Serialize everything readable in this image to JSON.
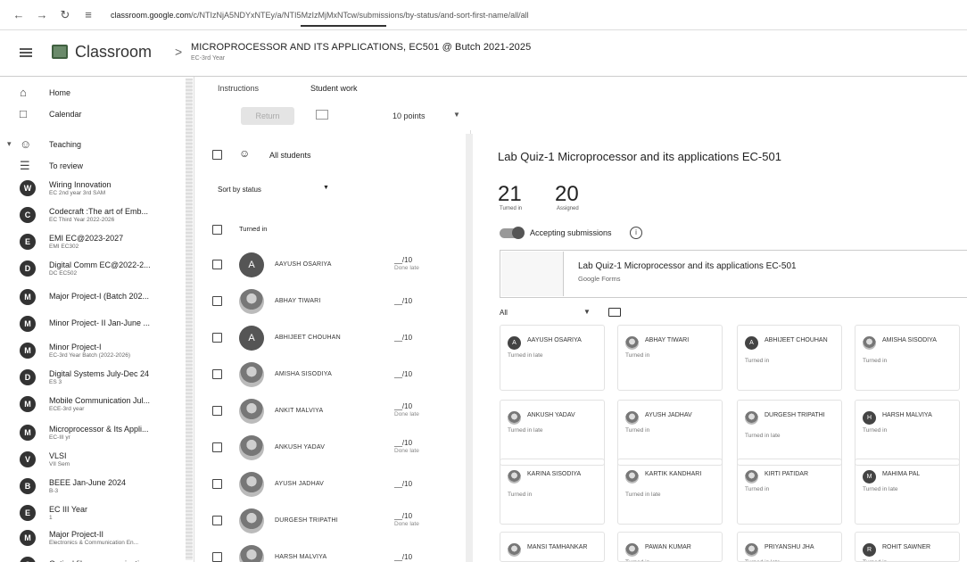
{
  "browser": {
    "url_host": "classroom.google.com",
    "url_path": "/c/NTIzNjA5NDYxNTEy/a/NTI5MzIzMjMxNTcw/submissions/by-status/and-sort-first-name/all/all"
  },
  "header": {
    "app_name": "Classroom",
    "separator": ">",
    "class_title": "MICROPROCESSOR AND ITS APPLICATIONS, EC501 @ Butch 2021-2025",
    "class_sub": "EC-3rd Year"
  },
  "sidebar": {
    "items": [
      {
        "title": "Home",
        "sub": "",
        "icon": "home-icon",
        "initial": ""
      },
      {
        "title": "Calendar",
        "sub": "",
        "icon": "calendar-icon",
        "initial": ""
      },
      {
        "title": "Teaching",
        "sub": "",
        "icon": "people-icon",
        "initial": ""
      },
      {
        "title": "To review",
        "sub": "",
        "icon": "review-icon",
        "initial": ""
      },
      {
        "title": "Wiring Innovation",
        "sub": "EC 2nd year 3rd SAM",
        "icon": "class-icon",
        "initial": "W"
      },
      {
        "title": "Codecraft :The art of Emb...",
        "sub": "EC Third Year 2022-2026",
        "icon": "class-icon",
        "initial": "C"
      },
      {
        "title": "EMI EC@2023-2027",
        "sub": "EMI EC302",
        "icon": "class-icon",
        "initial": "E"
      },
      {
        "title": "Digital Comm EC@2022-2...",
        "sub": "DC EC502",
        "icon": "class-icon",
        "initial": "D"
      },
      {
        "title": "Major Project-I (Batch 202...",
        "sub": "",
        "icon": "class-icon",
        "initial": "M"
      },
      {
        "title": "Minor Project- II Jan-June ...",
        "sub": "",
        "icon": "class-icon",
        "initial": "M"
      },
      {
        "title": "Minor Project-I",
        "sub": "EC-3rd Year Batch (2022-2026)",
        "icon": "class-icon",
        "initial": "M"
      },
      {
        "title": "Digital Systems July-Dec 24",
        "sub": "ES 3",
        "icon": "class-icon",
        "initial": "D"
      },
      {
        "title": "Mobile Communication Jul...",
        "sub": "ECE-3rd year",
        "icon": "class-icon",
        "initial": "M"
      },
      {
        "title": "Microprocessor & Its Appli...",
        "sub": "EC-III yr",
        "icon": "class-icon",
        "initial": "M"
      },
      {
        "title": "VLSI",
        "sub": "VII Sem",
        "icon": "class-icon",
        "initial": "V"
      },
      {
        "title": "BEEE Jan-June 2024",
        "sub": "B-3",
        "icon": "class-icon",
        "initial": "B"
      },
      {
        "title": "EC III Year",
        "sub": "1",
        "icon": "class-icon",
        "initial": "E"
      },
      {
        "title": "Major Project-II",
        "sub": "Electronics & Communication En...",
        "icon": "class-icon",
        "initial": "M"
      },
      {
        "title": "Optical fiber communicati...",
        "sub": "",
        "icon": "class-icon",
        "initial": "O"
      }
    ]
  },
  "tabs": {
    "instructions": "Instructions",
    "student_work": "Student work"
  },
  "toolbar": {
    "return_label": "Return",
    "points": "10 points"
  },
  "list": {
    "all_students": "All students",
    "sort_by": "Sort by status",
    "turned_in_header": "Turned in",
    "students": [
      {
        "name": "AAYUSH OSARIYA",
        "score": "__/10",
        "note": "Done late",
        "initial": "A",
        "photo": false
      },
      {
        "name": "ABHAY TIWARI",
        "score": "__/10",
        "note": "",
        "initial": "",
        "photo": true
      },
      {
        "name": "ABHIJEET CHOUHAN",
        "score": "__/10",
        "note": "",
        "initial": "A",
        "photo": false
      },
      {
        "name": "AMISHA SISODIYA",
        "score": "__/10",
        "note": "",
        "initial": "",
        "photo": true
      },
      {
        "name": "ANKIT MALVIYA",
        "score": "__/10",
        "note": "Done late",
        "initial": "",
        "photo": true
      },
      {
        "name": "ANKUSH YADAV",
        "score": "__/10",
        "note": "Done late",
        "initial": "",
        "photo": true
      },
      {
        "name": "AYUSH JADHAV",
        "score": "__/10",
        "note": "",
        "initial": "",
        "photo": true
      },
      {
        "name": "DURGESH TRIPATHI",
        "score": "__/10",
        "note": "Done late",
        "initial": "",
        "photo": true
      },
      {
        "name": "HARSH MALVIYA",
        "score": "__/10",
        "note": "",
        "initial": "",
        "photo": true
      }
    ]
  },
  "assignment": {
    "title": "Lab Quiz-1 Microprocessor and its applications EC-501",
    "turned_in_count": "21",
    "turned_in_label": "Turned in",
    "assigned_count": "20",
    "assigned_label": "Assigned",
    "accepting": "Accepting submissions",
    "form_title": "Lab Quiz-1 Microprocessor and its applications EC-501",
    "form_sub": "Google Forms",
    "filter": "All"
  },
  "grid": [
    {
      "name": "AAYUSH OSARIYA",
      "status": "Turned in late",
      "initial": "A",
      "photo": false
    },
    {
      "name": "ABHAY TIWARI",
      "status": "Turned in",
      "initial": "",
      "photo": true
    },
    {
      "name": "ABHIJEET CHOUHAN",
      "status": "Turned in",
      "initial": "A",
      "photo": false
    },
    {
      "name": "AMISHA SISODIYA",
      "status": "Turned in",
      "initial": "",
      "photo": true
    },
    {
      "name": "ANKUSH YADAV",
      "status": "Turned in late",
      "initial": "",
      "photo": true
    },
    {
      "name": "AYUSH JADHAV",
      "status": "Turned in",
      "initial": "",
      "photo": true
    },
    {
      "name": "DURGESH TRIPATHI",
      "status": "Turned in late",
      "initial": "",
      "photo": true
    },
    {
      "name": "HARSH MALVIYA",
      "status": "Turned in",
      "initial": "H",
      "photo": false
    },
    {
      "name": "KARINA SISODIYA",
      "status": "Turned in",
      "initial": "",
      "photo": true
    },
    {
      "name": "KARTIK KANDHARI",
      "status": "Turned in late",
      "initial": "",
      "photo": true
    },
    {
      "name": "KIRTI PATIDAR",
      "status": "Turned in",
      "initial": "",
      "photo": true
    },
    {
      "name": "MAHIMA PAL",
      "status": "Turned in late",
      "initial": "M",
      "photo": false
    },
    {
      "name": "MANSI TAMHANKAR",
      "status": "",
      "initial": "",
      "photo": true
    },
    {
      "name": "PAWAN KUMAR",
      "status": "Turned in",
      "initial": "",
      "photo": true
    },
    {
      "name": "PRIYANSHU JHA",
      "status": "Turned in late",
      "initial": "",
      "photo": true
    },
    {
      "name": "ROHIT SAWNER",
      "status": "Turned in",
      "initial": "R",
      "photo": false
    }
  ]
}
